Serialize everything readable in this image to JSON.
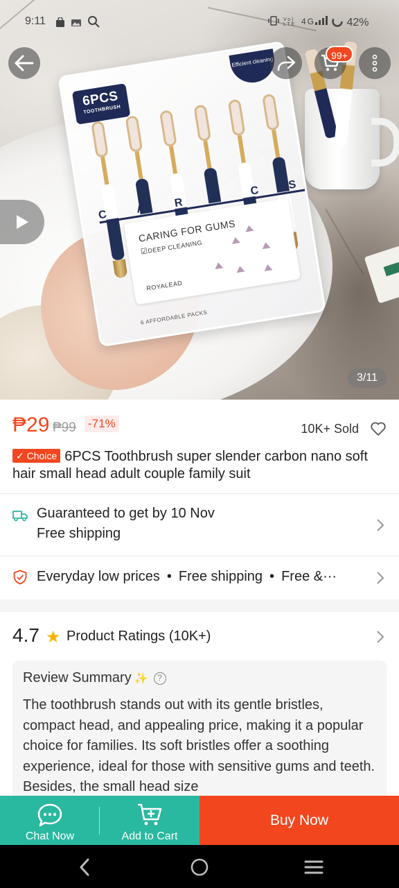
{
  "status_bar": {
    "time": "9:11",
    "left_icons": [
      "shopping-bag-icon",
      "image-icon",
      "search-icon"
    ],
    "right_icons": [
      "vibrate-icon",
      "volte-icon",
      "4g-signal-icon"
    ],
    "battery": "42%"
  },
  "gallery": {
    "pager": "3/11",
    "cart_badge": "99+"
  },
  "product_image": {
    "pack_label": "6PCS",
    "pack_sublabel": "TOOTHBRUSH",
    "pack_badge": "Efficient cleaning",
    "letters": "CARDCS",
    "card_title": "CARING FOR GUMS",
    "card_sub": "DEEP CLEANING",
    "card_brand": "ROYALEAD",
    "foot": "6 AFFORDABLE PACKS"
  },
  "price": {
    "current": "₱29",
    "original": "₱99",
    "discount": "-71%",
    "sold": "10K+ Sold"
  },
  "title": {
    "badge": "✓ Choice",
    "text": "6PCS Toothbrush super slender carbon nano soft hair small head adult couple family suit"
  },
  "delivery": {
    "line1": "Guaranteed to get by 10 Nov",
    "line2": "Free shipping"
  },
  "value_props": {
    "items": [
      "Everyday low prices",
      "Free shipping",
      "Free &···"
    ]
  },
  "ratings": {
    "score": "4.7",
    "label": "Product Ratings (10K+)"
  },
  "review_summary": {
    "title": "Review Summary",
    "body": "The toothbrush stands out with its gentle bristles, compact head, and appealing price, making it a popular choice for families. Its soft bristles offer a soothing experience, ideal for those with sensitive gums and teeth. Besides, the small head size"
  },
  "bottom_bar": {
    "chat": "Chat Now",
    "add_to_cart": "Add to Cart",
    "buy_now": "Buy Now"
  },
  "colors": {
    "accent": "#f2461e",
    "teal": "#29b8a0",
    "star": "#f5b400"
  }
}
